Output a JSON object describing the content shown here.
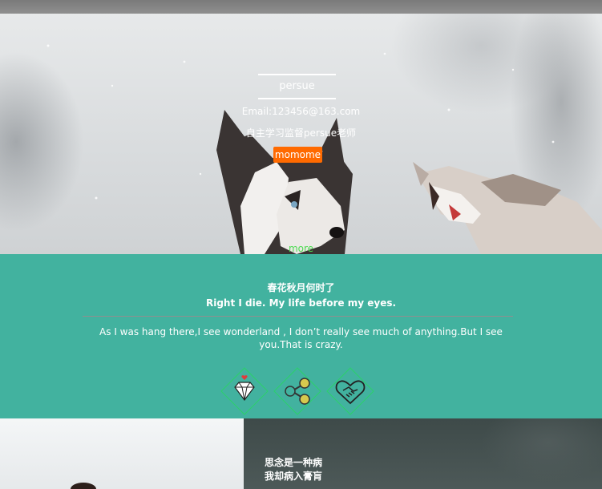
{
  "hero": {
    "name": "persue",
    "email": "Email:123456@163.com",
    "motto": "自主学习监督persue老师",
    "button_label": "momome",
    "more_link": "more"
  },
  "feature": {
    "title": "春花秋月何时了",
    "subtitle": "Right I die. My life before my eyes.",
    "body": "As I was hang there,I see wonderland , I don’t really see much of anything.But I see you.That is crazy.",
    "icons": [
      "diamond-icon",
      "share-icon",
      "handshake-icon"
    ],
    "accent_color": "#42b29f",
    "icon_border_color": "#2bd16b"
  },
  "bottom": {
    "line1": "思念是一种病",
    "line2": "我却病入膏肓"
  },
  "colors": {
    "button": "#ff6a00",
    "more_link": "#4edb52"
  }
}
